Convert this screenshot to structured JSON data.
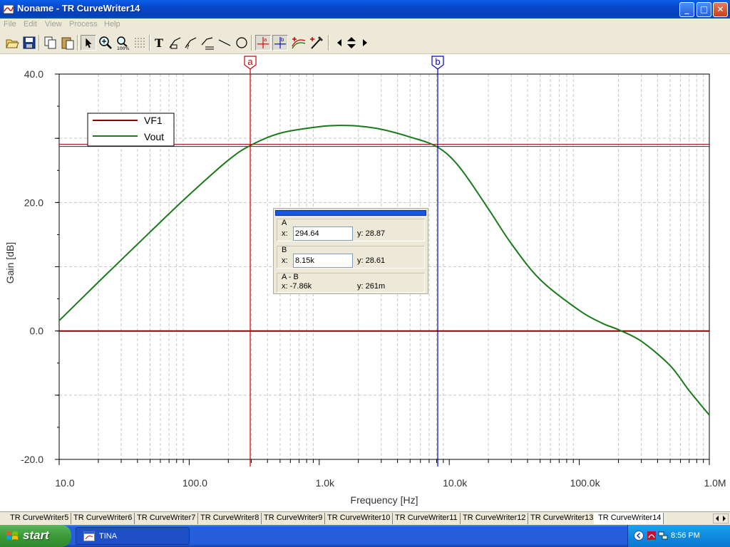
{
  "window": {
    "title": "Noname - TR CurveWriter14",
    "buttons": {
      "minimize": "_",
      "maximize": "□",
      "close": "✕"
    }
  },
  "menu": [
    "File",
    "Edit",
    "View",
    "Process",
    "Help"
  ],
  "toolbar": {
    "icons": [
      "open-icon",
      "save-icon",
      "copy-icon",
      "paste-icon",
      "pointer-icon",
      "zoom-in-icon",
      "zoom-100-icon",
      "grid-icon",
      "text-icon",
      "label-icon",
      "label-query-icon",
      "label-line-icon",
      "line-icon",
      "ellipse-icon",
      "cursor-a-icon",
      "cursor-b-icon",
      "curve-add-icon",
      "probe-icon",
      "arrow-left-icon",
      "arrow-updown-icon",
      "arrow-right-icon"
    ],
    "glyphs": {
      "text": "T",
      "cursor_a": "a",
      "cursor_b": "b"
    }
  },
  "chart_data": {
    "type": "line",
    "xlabel": "Frequency [Hz]",
    "ylabel": "Gain [dB]",
    "xscale": "log",
    "xlim": [
      10,
      1000000
    ],
    "ylim": [
      -20,
      40
    ],
    "grid": true,
    "x_tick_labels": [
      "10.0",
      "100.0",
      "1.0k",
      "10.0k",
      "100.0k",
      "1.0M"
    ],
    "y_tick_labels": [
      "40.0",
      "20.0",
      "0.0",
      "-20.0"
    ],
    "y_ticks": [
      40,
      20,
      0,
      -20
    ],
    "legend": {
      "position": "top-left",
      "entries": [
        "VF1",
        "Vout"
      ]
    },
    "series": [
      {
        "name": "VF1",
        "color": "#8b0000",
        "x": [
          10,
          1000000
        ],
        "y": [
          0,
          0
        ]
      },
      {
        "name": "Vout",
        "color": "#1a7a1a",
        "x": [
          10,
          20,
          50,
          100,
          200,
          294.64,
          500,
          1000,
          1500,
          2000,
          3000,
          5000,
          8150,
          12000,
          20000,
          30000,
          50000,
          100000,
          150000,
          200000,
          300000,
          500000,
          700000,
          1000000
        ],
        "y": [
          1.6,
          7.6,
          15.4,
          21.2,
          26.6,
          28.87,
          30.8,
          31.8,
          32.0,
          31.9,
          31.4,
          30.2,
          28.61,
          25.5,
          19.0,
          13.6,
          8.0,
          3.2,
          1.2,
          0.2,
          -1.6,
          -5.4,
          -9.3,
          -13.1
        ]
      }
    ],
    "reference_line": {
      "y": 28.9,
      "color": "#8b0000"
    },
    "cursors": [
      {
        "label": "a",
        "x": 294.64,
        "color": "#cc0000"
      },
      {
        "label": "b",
        "x": 8150,
        "color": "#0000cc"
      }
    ]
  },
  "readout": {
    "a": {
      "label": "A",
      "x_label": "x:",
      "x_value": "294.64",
      "y_text": "y: 28.87"
    },
    "b": {
      "label": "B",
      "x_label": "x:",
      "x_value": "8.15k",
      "y_text": "y: 28.61"
    },
    "diff": {
      "label": "A - B",
      "x_text": "x:  -7.86k",
      "y_text": "y: 261m"
    }
  },
  "sheet_tabs": [
    "TR CurveWriter5",
    "TR CurveWriter6",
    "TR CurveWriter7",
    "TR CurveWriter8",
    "TR CurveWriter9",
    "TR CurveWriter10",
    "TR CurveWriter11",
    "TR CurveWriter12",
    "TR CurveWriter13",
    "TR CurveWriter14"
  ],
  "active_tab": "TR CurveWriter14",
  "taskbar": {
    "start_label": "start",
    "task_label": "TINA",
    "clock": "8:56 PM",
    "tray_icons": [
      "chevron-left-icon",
      "pdf-icon",
      "network-icon",
      "volume-icon"
    ]
  }
}
